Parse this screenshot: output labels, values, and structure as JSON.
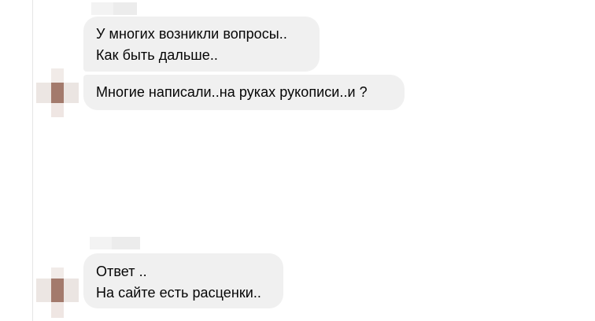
{
  "conversation": {
    "group_1": {
      "messages": [
        {
          "lines": [
            "У многих возникли вопросы..",
            "Как быть дальше.."
          ]
        },
        {
          "lines": [
            "Многие написали..на руках рукописи..и ?"
          ]
        }
      ]
    },
    "group_2": {
      "messages": [
        {
          "lines": [
            "Ответ ..",
            "На сайте есть расценки.."
          ]
        }
      ]
    }
  },
  "colors": {
    "bubble_background": "#f0f0f0",
    "text": "#050505",
    "avatar_main": "#a37a6c"
  }
}
